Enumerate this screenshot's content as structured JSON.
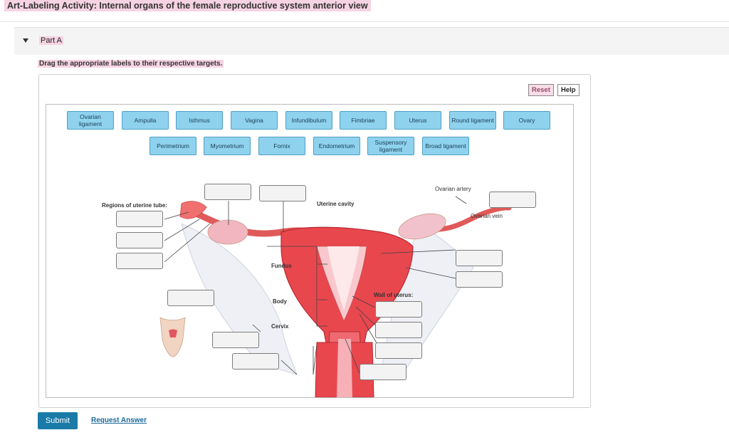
{
  "title": "Art-Labeling Activity: Internal organs of the female reproductive system anterior view",
  "part": {
    "label": "Part A"
  },
  "instructions": "Drag the appropriate labels to their respective targets.",
  "toolbar": {
    "reset_label": "Reset",
    "help_label": "Help"
  },
  "labels_row1": [
    "Ovarian ligament",
    "Ampulla",
    "Isthmus",
    "Vagina",
    "Infundibulum",
    "Fimbriae",
    "Uterus",
    "Round ligament",
    "Ovary"
  ],
  "labels_row2": [
    "Perimetrium",
    "Myometrium",
    "Fornix",
    "Endometrium",
    "Suspensory ligament",
    "Broad ligament"
  ],
  "diagram": {
    "regions_uterine_tube": "Regions of uterine tube:",
    "uterine_cavity": "Uterine cavity",
    "ovarian_artery": "Ovarian artery",
    "ovarian_vein": "Ovarian vein",
    "fundus": "Fundus",
    "body": "Body",
    "cervix": "Cervix",
    "wall_of_uterus": "Wall of uterus:"
  },
  "actions": {
    "submit_label": "Submit",
    "request_answer_label": "Request Answer"
  },
  "colors": {
    "accent": "#1a7aa8",
    "chip": "#8fd2ee",
    "highlight": "#f6d3e2"
  }
}
